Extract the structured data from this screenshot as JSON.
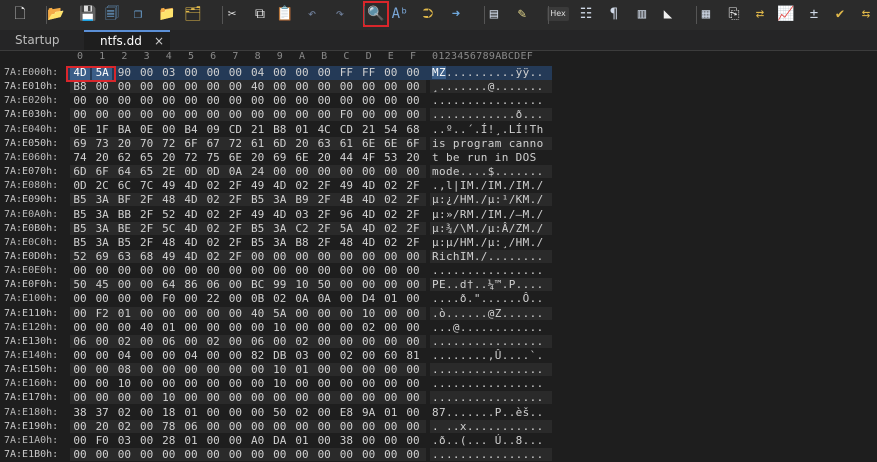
{
  "toolbar": {
    "buttons": [
      {
        "name": "new-file-icon",
        "glyph": "🗋",
        "color": "#e8e8e8"
      },
      {
        "name": "open-folder-icon",
        "glyph": "📂",
        "color": "#e0b84a"
      },
      {
        "name": "save-icon",
        "glyph": "💾",
        "color": "#6fa8dc"
      },
      {
        "name": "save-all-icon",
        "glyph": "🗐",
        "color": "#6fa8dc"
      },
      {
        "name": "copy-file-icon",
        "glyph": "❐",
        "color": "#6fa8dc"
      },
      {
        "name": "folder-icon",
        "glyph": "📁",
        "color": "#e0b84a"
      },
      {
        "name": "folders-icon",
        "glyph": "🗂",
        "color": "#e0b84a"
      },
      {
        "name": "cut-icon",
        "glyph": "✂",
        "color": "#e8e8e8"
      },
      {
        "name": "copy-icon",
        "glyph": "⧉",
        "color": "#e8e8e8"
      },
      {
        "name": "paste-icon",
        "glyph": "📋",
        "color": "#e0d48a"
      },
      {
        "name": "undo-icon",
        "glyph": "↶",
        "color": "#6f7f9a"
      },
      {
        "name": "redo-icon",
        "glyph": "↷",
        "color": "#6f7f9a"
      },
      {
        "name": "find-icon",
        "glyph": "🔍",
        "color": "#f0f0f0"
      },
      {
        "name": "replace-icon",
        "glyph": "Aᵇ",
        "color": "#7aa7d8"
      },
      {
        "name": "find-next-icon",
        "glyph": "⮊",
        "color": "#e0b84a"
      },
      {
        "name": "goto-icon",
        "glyph": "➜",
        "color": "#6fa8dc"
      },
      {
        "name": "page-icon",
        "glyph": "▤",
        "color": "#cfd8e6"
      },
      {
        "name": "clipboard-edit-icon",
        "glyph": "✎",
        "color": "#e0d48a"
      },
      {
        "name": "hex-mode-badge",
        "glyph": "Hex",
        "color": "#dddddd"
      },
      {
        "name": "ruler-icon",
        "glyph": "☷",
        "color": "#cfd8e6"
      },
      {
        "name": "pilcrow-icon",
        "glyph": "¶",
        "color": "#cfd8e6"
      },
      {
        "name": "columns-icon",
        "glyph": "▥",
        "color": "#cfd8e6"
      },
      {
        "name": "tag-icon",
        "glyph": "◣",
        "color": "#f0f0f0"
      },
      {
        "name": "calculator-icon",
        "glyph": "▦",
        "color": "#cfd8e6"
      },
      {
        "name": "export-icon",
        "glyph": "⎘",
        "color": "#e8e8e8"
      },
      {
        "name": "swap-icon",
        "glyph": "⇄",
        "color": "#e0b84a"
      },
      {
        "name": "chart-icon",
        "glyph": "📈",
        "color": "#6fa8dc"
      },
      {
        "name": "plus-minus-icon",
        "glyph": "±",
        "color": "#cfd8e6"
      },
      {
        "name": "checksum-icon",
        "glyph": "✔",
        "color": "#e0b84a"
      },
      {
        "name": "compare-icon",
        "glyph": "⇆",
        "color": "#e0b84a"
      }
    ]
  },
  "tabs": [
    {
      "label": "Startup"
    },
    {
      "label": "ntfs.dd",
      "close": "×"
    }
  ],
  "column_header": [
    "0",
    "1",
    "2",
    "3",
    "4",
    "5",
    "6",
    "7",
    "8",
    "9",
    "A",
    "B",
    "C",
    "D",
    "E",
    "F"
  ],
  "ascii_header": "0123456789ABCDEF",
  "rows": [
    {
      "offset": "7A:E000h:",
      "bytes": "4D 5A 90 00 03 00 00 00 04 00 00 00 FF FF 00 00",
      "ascii": "MZ..........ÿÿ.."
    },
    {
      "offset": "7A:E010h:",
      "bytes": "B8 00 00 00 00 00 00 00 40 00 00 00 00 00 00 00",
      "ascii": "¸.......@......."
    },
    {
      "offset": "7A:E020h:",
      "bytes": "00 00 00 00 00 00 00 00 00 00 00 00 00 00 00 00",
      "ascii": "................"
    },
    {
      "offset": "7A:E030h:",
      "bytes": "00 00 00 00 00 00 00 00 00 00 00 00 F0 00 00 00",
      "ascii": "............ð..."
    },
    {
      "offset": "7A:E040h:",
      "bytes": "0E 1F BA 0E 00 B4 09 CD 21 B8 01 4C CD 21 54 68",
      "ascii": "..º..´.Í!¸.LÍ!Th"
    },
    {
      "offset": "7A:E050h:",
      "bytes": "69 73 20 70 72 6F 67 72 61 6D 20 63 61 6E 6E 6F",
      "ascii": "is program canno"
    },
    {
      "offset": "7A:E060h:",
      "bytes": "74 20 62 65 20 72 75 6E 20 69 6E 20 44 4F 53 20",
      "ascii": "t be run in DOS "
    },
    {
      "offset": "7A:E070h:",
      "bytes": "6D 6F 64 65 2E 0D 0D 0A 24 00 00 00 00 00 00 00",
      "ascii": "mode....$......."
    },
    {
      "offset": "7A:E080h:",
      "bytes": "0D 2C 6C 7C 49 4D 02 2F 49 4D 02 2F 49 4D 02 2F",
      "ascii": ".,l|IM./IM./IM./"
    },
    {
      "offset": "7A:E090h:",
      "bytes": "B5 3A BF 2F 48 4D 02 2F B5 3A B9 2F 4B 4D 02 2F",
      "ascii": "µ:¿/HM./µ:¹/KM./"
    },
    {
      "offset": "7A:E0A0h:",
      "bytes": "B5 3A BB 2F 52 4D 02 2F 49 4D 03 2F 96 4D 02 2F",
      "ascii": "µ:»/RM./IM./–M./"
    },
    {
      "offset": "7A:E0B0h:",
      "bytes": "B5 3A BE 2F 5C 4D 02 2F B5 3A C2 2F 5A 4D 02 2F",
      "ascii": "µ:¾/\\M./µ:Â/ZM./"
    },
    {
      "offset": "7A:E0C0h:",
      "bytes": "B5 3A B5 2F 48 4D 02 2F B5 3A B8 2F 48 4D 02 2F",
      "ascii": "µ:µ/HM./µ:¸/HM./"
    },
    {
      "offset": "7A:E0D0h:",
      "bytes": "52 69 63 68 49 4D 02 2F 00 00 00 00 00 00 00 00",
      "ascii": "RichIM./........"
    },
    {
      "offset": "7A:E0E0h:",
      "bytes": "00 00 00 00 00 00 00 00 00 00 00 00 00 00 00 00",
      "ascii": "................"
    },
    {
      "offset": "7A:E0F0h:",
      "bytes": "50 45 00 00 64 86 06 00 BC 99 10 50 00 00 00 00",
      "ascii": "PE..d†..¼™.P...."
    },
    {
      "offset": "7A:E100h:",
      "bytes": "00 00 00 00 F0 00 22 00 0B 02 0A 0A 00 D4 01 00",
      "ascii": "....ð.\"......Ô.."
    },
    {
      "offset": "7A:E110h:",
      "bytes": "00 F2 01 00 00 00 00 00 40 5A 00 00 00 10 00 00",
      "ascii": ".ò......@Z......"
    },
    {
      "offset": "7A:E120h:",
      "bytes": "00 00 00 40 01 00 00 00 00 10 00 00 00 02 00 00",
      "ascii": "...@............"
    },
    {
      "offset": "7A:E130h:",
      "bytes": "06 00 02 00 06 00 02 00 06 00 02 00 00 00 00 00",
      "ascii": "................"
    },
    {
      "offset": "7A:E140h:",
      "bytes": "00 00 04 00 00 04 00 00 82 DB 03 00 02 00 60 81",
      "ascii": "........‚Û....`."
    },
    {
      "offset": "7A:E150h:",
      "bytes": "00 00 08 00 00 00 00 00 00 10 01 00 00 00 00 00",
      "ascii": "................"
    },
    {
      "offset": "7A:E160h:",
      "bytes": "00 00 10 00 00 00 00 00 00 10 00 00 00 00 00 00",
      "ascii": "................"
    },
    {
      "offset": "7A:E170h:",
      "bytes": "00 00 00 00 10 00 00 00 00 00 00 00 00 00 00 00",
      "ascii": "................"
    },
    {
      "offset": "7A:E180h:",
      "bytes": "38 37 02 00 18 01 00 00 00 50 02 00 E8 9A 01 00",
      "ascii": "87.......P..èš.."
    },
    {
      "offset": "7A:E190h:",
      "bytes": "00 20 02 00 78 06 00 00 00 00 00 00 00 00 00 00",
      "ascii": ". ..x..........."
    },
    {
      "offset": "7A:E1A0h:",
      "bytes": "00 F0 03 00 28 01 00 00 A0 DA 01 00 38 00 00 00",
      "ascii": ".ð..(... Ú..8..."
    },
    {
      "offset": "7A:E1B0h:",
      "bytes": "00 00 00 00 00 00 00 00 00 00 00 00 00 00 00 00",
      "ascii": "................"
    }
  ],
  "selection": {
    "row": 0,
    "bytes": [
      0,
      1
    ]
  },
  "colors": {
    "selection": "#3b5e88",
    "highlight_box": "#d9262b",
    "tab_accent": "#5b8fd6"
  }
}
